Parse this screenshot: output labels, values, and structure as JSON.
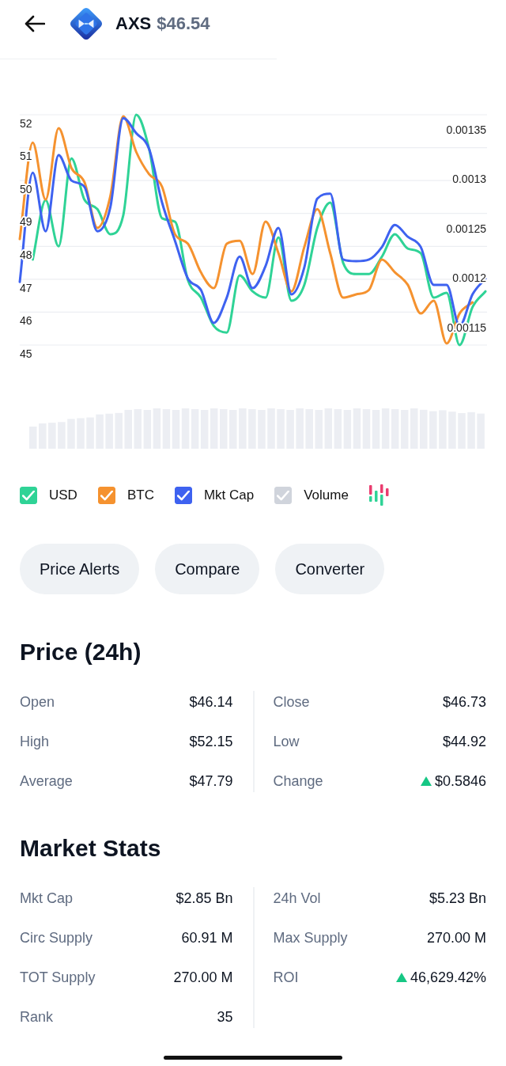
{
  "header": {
    "symbol": "AXS",
    "price": "$46.54"
  },
  "chart": {
    "chart_data": {
      "type": "line",
      "grid": true,
      "ylim": [
        45,
        52
      ],
      "yticks": [
        45,
        46,
        47,
        48,
        49,
        50,
        51,
        52
      ],
      "series": [
        {
          "name": "USD",
          "color": "#2fd396",
          "values": [
            null,
            47.6,
            49.4,
            48.0,
            50.67,
            49.42,
            49.13,
            48.37,
            48.94,
            52.0,
            50.96,
            48.85,
            48.75,
            46.97,
            46.44,
            45.58,
            45.38,
            47.12,
            46.63,
            46.44,
            48.27,
            46.35,
            46.83,
            48.56,
            49.33,
            47.5,
            47.16,
            47.16,
            47.69,
            48.37,
            47.93,
            47.79,
            46.44,
            46.59,
            45.0,
            46.15,
            46.63
          ]
        },
        {
          "name": "BTC",
          "color": "#f5922f",
          "values": [
            48.22,
            51.15,
            49.42,
            51.59,
            50.38,
            49.95,
            48.56,
            49.52,
            51.95,
            50.87,
            50.19,
            49.81,
            48.37,
            48.08,
            47.21,
            46.73,
            48.08,
            48.17,
            47.16,
            48.75,
            47.79,
            46.63,
            47.98,
            49.13,
            47.79,
            46.44,
            46.54,
            46.68,
            47.6,
            47.21,
            46.83,
            45.96,
            46.35,
            45.05,
            45.96,
            46.3,
            null
          ]
        },
        {
          "name": "Mkt Cap",
          "color": "#3e62f0",
          "values": [
            46.92,
            50.24,
            48.46,
            50.77,
            50.0,
            49.81,
            48.46,
            49.18,
            51.9,
            51.44,
            50.96,
            49.33,
            48.17,
            47.02,
            46.68,
            45.67,
            46.44,
            47.69,
            46.73,
            47.4,
            48.56,
            46.54,
            47.36,
            49.45,
            49.6,
            47.6,
            47.55,
            47.6,
            47.98,
            48.65,
            48.29,
            47.98,
            46.83,
            46.83,
            45.58,
            46.54,
            47.02
          ]
        }
      ]
    },
    "right_axis_labels": [
      "0.00135",
      "0.0013",
      "0.00125",
      "0.0012",
      "0.00115"
    ]
  },
  "legend": [
    {
      "checked": true
    },
    {
      "checked": true
    },
    {
      "checked": true
    }
  ],
  "volume": {
    "label": "Volume",
    "checked": true,
    "color": "#d0d4dc"
  },
  "actions": [
    {
      "label": "Price Alerts"
    },
    {
      "label": "Compare"
    },
    {
      "label": "Converter"
    }
  ],
  "price_24h": {
    "title": "Price (24h)",
    "left": [
      {
        "label": "Open",
        "value": "$46.14"
      },
      {
        "label": "High",
        "value": "$52.15"
      },
      {
        "label": "Average",
        "value": "$47.79"
      }
    ],
    "right": [
      {
        "label": "Close",
        "value": "$46.73"
      },
      {
        "label": "Low",
        "value": "$44.92"
      },
      {
        "label": "Change",
        "value": "$0.5846",
        "rising": true
      }
    ]
  },
  "market_stats": {
    "title": "Market Stats",
    "left": [
      {
        "label": "Mkt Cap",
        "value": "$2.85 Bn"
      },
      {
        "label": "Circ Supply",
        "value": "60.91 M"
      },
      {
        "label": "TOT Supply",
        "value": "270.00 M"
      },
      {
        "label": "Rank",
        "value": "35"
      }
    ],
    "right": [
      {
        "label": "24h Vol",
        "value": "$5.23 Bn"
      },
      {
        "label": "Max Supply",
        "value": "270.00 M"
      },
      {
        "label": "ROI",
        "value": "46,629.42%",
        "rising": true
      }
    ]
  }
}
